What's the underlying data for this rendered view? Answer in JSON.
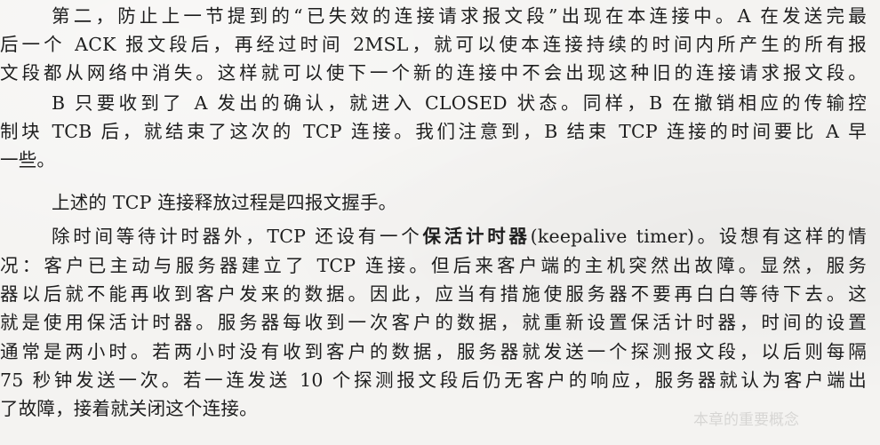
{
  "paragraphs": [
    {
      "lines": [
        "第二，防止上一节提到的“已失效的连接请求报文段”出现在本连接中。A 在发送完最",
        "后一个 ACK 报文段后，再经过时间 2MSL，就可以使本连接持续的时间内所产生的所有报",
        "文段都从网络中消失。这样就可以使下一个新的连接中不会出现这种旧的连接请求报文段。"
      ]
    },
    {
      "lines": [
        "B 只要收到了 A 发出的确认，就进入 CLOSED 状态。同样，B 在撤销相应的传输控",
        "制块 TCB 后，就结束了这次的 TCP 连接。我们注意到，B 结束 TCP 连接的时间要比 A 早",
        "一些。"
      ]
    },
    {
      "lines": [
        "上述的 TCP 连接释放过程是四报文握手。"
      ]
    },
    {
      "lines": [
        "除时间等待计时器外，TCP 还设有一个",
        "保活计时器",
        "(keepalive timer)。设想有这样的情",
        "况：客户已主动与服务器建立了 TCP 连接。但后来客户端的主机突然出故障。显然，服务",
        "器以后就不能再收到客户发来的数据。因此，应当有措施使服务器不要再白白等待下去。这",
        "就是使用保活计时器。服务器每收到一次客户的数据，就重新设置保活计时器，时间的设置",
        "通常是两小时。若两小时没有收到客户的数据，服务器就发送一个探测报文段，以后则每隔",
        "75 秒钟发送一次。若一连发送 10 个探测报文段后仍无客户的响应，服务器就认为客户端出",
        "了故障，接着就关闭这个连接。"
      ]
    }
  ],
  "ghost": {
    "text_a": "本章的重要概念"
  }
}
